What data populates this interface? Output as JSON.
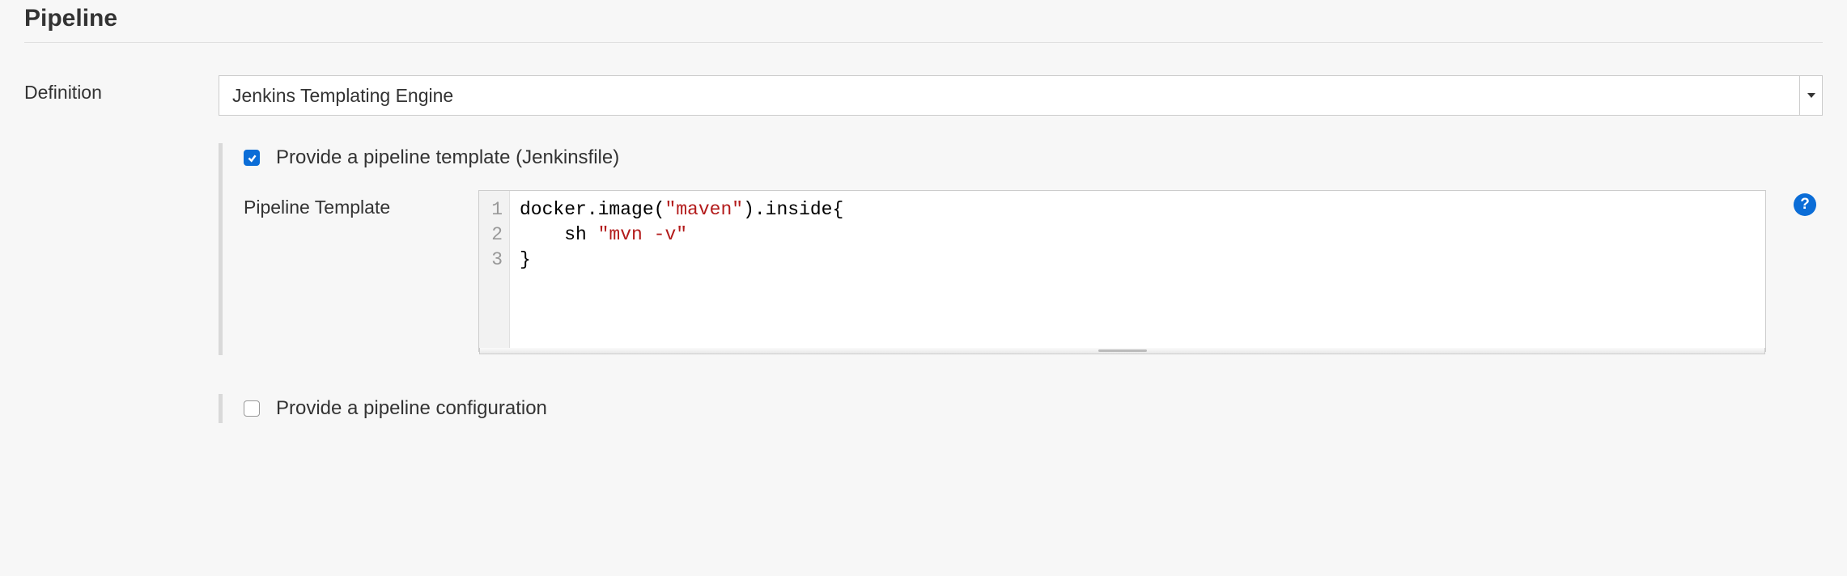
{
  "section": {
    "title": "Pipeline"
  },
  "definition": {
    "label": "Definition",
    "value": "Jenkins Templating Engine"
  },
  "provide_template": {
    "checked": true,
    "label": "Provide a pipeline template (Jenkinsfile)"
  },
  "template_editor": {
    "label": "Pipeline Template",
    "lines": [
      {
        "pre": "docker.image(",
        "str": "\"maven\"",
        "post": ").inside{"
      },
      {
        "pre": "    sh ",
        "str": "\"mvn -v\"",
        "post": ""
      },
      {
        "pre": "}",
        "str": "",
        "post": ""
      }
    ]
  },
  "provide_config": {
    "checked": false,
    "label": "Provide a pipeline configuration"
  },
  "help": {
    "glyph": "?"
  }
}
